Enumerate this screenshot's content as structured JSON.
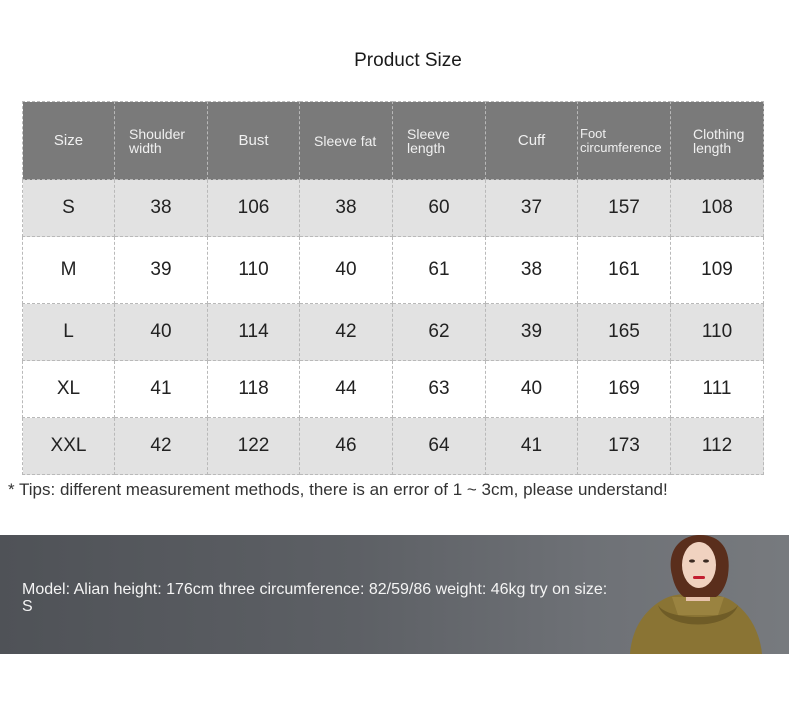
{
  "title": "Product Size",
  "columns": [
    "Size",
    "Shoulder width",
    "Bust",
    "Sleeve fat",
    "Sleeve length",
    "Cuff",
    "Foot circumference",
    "Clothing length"
  ],
  "rows": [
    [
      "S",
      "38",
      "106",
      "38",
      "60",
      "37",
      "157",
      "108"
    ],
    [
      "M",
      "39",
      "110",
      "40",
      "61",
      "38",
      "161",
      "109"
    ],
    [
      "L",
      "40",
      "114",
      "42",
      "62",
      "39",
      "165",
      "110"
    ],
    [
      "XL",
      "41",
      "118",
      "44",
      "63",
      "40",
      "169",
      "111"
    ],
    [
      "XXL",
      "42",
      "122",
      "46",
      "64",
      "41",
      "173",
      "112"
    ]
  ],
  "tip": "* Tips: different measurement methods, there is an error of 1 ~ 3cm, please understand!",
  "model_info": "Model: Alian height: 176cm three circumference: 82/59/86 weight: 46kg try on size: S",
  "colors": {
    "header_bg": "#7a7a7a",
    "row_gray": "#e2e2e2",
    "banner_bg": "#5d6065",
    "jacket": "#8a7434"
  }
}
